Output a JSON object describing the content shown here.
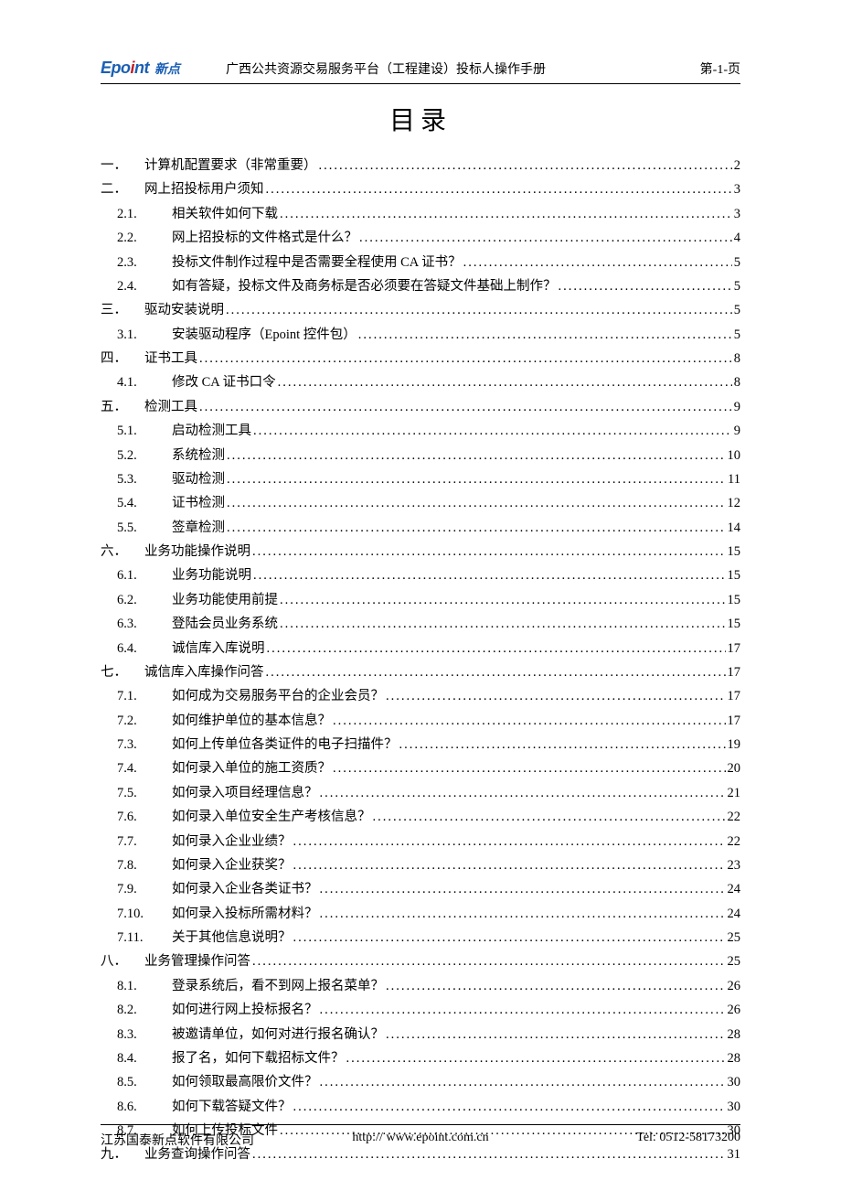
{
  "header": {
    "logo_en_prefix": "Epo",
    "logo_en_i": "i",
    "logo_en_suffix": "nt",
    "logo_cn": "新点",
    "title": "广西公共资源交易服务平台（工程建设）投标人操作手册",
    "page": "第-1-页"
  },
  "title": "目录",
  "toc": [
    {
      "lvl": 1,
      "num": "一．",
      "text": "计算机配置要求（非常重要）",
      "page": "2"
    },
    {
      "lvl": 1,
      "num": "二．",
      "text": "网上招投标用户须知",
      "page": "3"
    },
    {
      "lvl": 2,
      "num": "2.1.",
      "text": "相关软件如何下载",
      "page": "3"
    },
    {
      "lvl": 2,
      "num": "2.2.",
      "text": "网上招投标的文件格式是什么？",
      "page": "4"
    },
    {
      "lvl": 2,
      "num": "2.3.",
      "text": "投标文件制作过程中是否需要全程使用 CA 证书？",
      "page": "5"
    },
    {
      "lvl": 2,
      "num": "2.4.",
      "text": "如有答疑，投标文件及商务标是否必须要在答疑文件基础上制作？",
      "page": "5"
    },
    {
      "lvl": 1,
      "num": "三．",
      "text": "驱动安装说明",
      "page": "5"
    },
    {
      "lvl": 2,
      "num": "3.1.",
      "text": "安装驱动程序（Epoint 控件包）",
      "page": "5"
    },
    {
      "lvl": 1,
      "num": "四．",
      "text": "证书工具",
      "page": "8"
    },
    {
      "lvl": 2,
      "num": "4.1.",
      "text": "修改 CA 证书口令",
      "page": "8"
    },
    {
      "lvl": 1,
      "num": "五．",
      "text": "检测工具",
      "page": "9"
    },
    {
      "lvl": 2,
      "num": "5.1.",
      "text": "启动检测工具",
      "page": "9"
    },
    {
      "lvl": 2,
      "num": "5.2.",
      "text": "系统检测",
      "page": "10"
    },
    {
      "lvl": 2,
      "num": "5.3.",
      "text": "驱动检测",
      "page": "11"
    },
    {
      "lvl": 2,
      "num": "5.4.",
      "text": "证书检测",
      "page": "12"
    },
    {
      "lvl": 2,
      "num": "5.5.",
      "text": "签章检测",
      "page": "14"
    },
    {
      "lvl": 1,
      "num": "六．",
      "text": "业务功能操作说明",
      "page": "15"
    },
    {
      "lvl": 2,
      "num": "6.1.",
      "text": "业务功能说明",
      "page": "15"
    },
    {
      "lvl": 2,
      "num": "6.2.",
      "text": "业务功能使用前提",
      "page": "15"
    },
    {
      "lvl": 2,
      "num": "6.3.",
      "text": "登陆会员业务系统",
      "page": "15"
    },
    {
      "lvl": 2,
      "num": "6.4.",
      "text": "诚信库入库说明",
      "page": "17"
    },
    {
      "lvl": 1,
      "num": "七．",
      "text": "诚信库入库操作问答",
      "page": "17"
    },
    {
      "lvl": 2,
      "num": "7.1.",
      "text": "如何成为交易服务平台的企业会员？",
      "page": "17"
    },
    {
      "lvl": 2,
      "num": "7.2.",
      "text": "如何维护单位的基本信息？",
      "page": "17"
    },
    {
      "lvl": 2,
      "num": "7.3.",
      "text": "如何上传单位各类证件的电子扫描件？",
      "page": "19"
    },
    {
      "lvl": 2,
      "num": "7.4.",
      "text": "如何录入单位的施工资质？",
      "page": "20"
    },
    {
      "lvl": 2,
      "num": "7.5.",
      "text": "如何录入项目经理信息？",
      "page": "21"
    },
    {
      "lvl": 2,
      "num": "7.6.",
      "text": "如何录入单位安全生产考核信息？",
      "page": "22"
    },
    {
      "lvl": 2,
      "num": "7.7.",
      "text": "如何录入企业业绩？",
      "page": "22"
    },
    {
      "lvl": 2,
      "num": "7.8.",
      "text": "如何录入企业获奖？",
      "page": "23"
    },
    {
      "lvl": 2,
      "num": "7.9.",
      "text": "如何录入企业各类证书？",
      "page": "24"
    },
    {
      "lvl": 2,
      "num": "7.10.",
      "text": "如何录入投标所需材料？",
      "page": "24"
    },
    {
      "lvl": 2,
      "num": "7.11.",
      "text": "关于其他信息说明？",
      "page": "25"
    },
    {
      "lvl": 1,
      "num": "八．",
      "text": "业务管理操作问答",
      "page": "25"
    },
    {
      "lvl": 2,
      "num": "8.1.",
      "text": "登录系统后，看不到网上报名菜单？",
      "page": "26"
    },
    {
      "lvl": 2,
      "num": "8.2.",
      "text": "如何进行网上投标报名？",
      "page": "26"
    },
    {
      "lvl": 2,
      "num": "8.3.",
      "text": "被邀请单位，如何对进行报名确认？",
      "page": "28"
    },
    {
      "lvl": 2,
      "num": "8.4.",
      "text": "报了名，如何下载招标文件？",
      "page": "28"
    },
    {
      "lvl": 2,
      "num": "8.5.",
      "text": "如何领取最高限价文件？",
      "page": "30"
    },
    {
      "lvl": 2,
      "num": "8.6.",
      "text": "如何下载答疑文件？",
      "page": "30"
    },
    {
      "lvl": 2,
      "num": "8.7.",
      "text": "如何上传投标文件",
      "page": "30"
    },
    {
      "lvl": 1,
      "num": "九．",
      "text": "业务查询操作问答",
      "page": "31"
    }
  ],
  "footer": {
    "left": "江苏国泰新点软件有限公司",
    "center": "http:// www.epoint.com.cn",
    "right": "Tel: 0512-58173200"
  }
}
